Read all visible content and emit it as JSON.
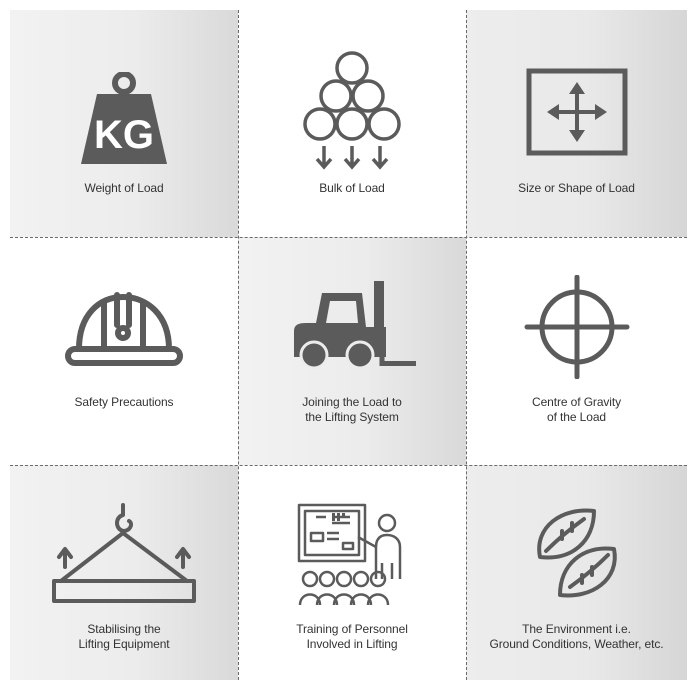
{
  "cells": [
    {
      "icon": "weight-kg-icon",
      "icon_text": "KG",
      "line1": "Weight of Load",
      "line2": ""
    },
    {
      "icon": "stacked-pipes-icon",
      "line1": "Bulk of Load",
      "line2": ""
    },
    {
      "icon": "move-arrows-icon",
      "line1": "Size or Shape of Load",
      "line2": ""
    },
    {
      "icon": "hard-hat-icon",
      "line1": "Safety Precautions",
      "line2": ""
    },
    {
      "icon": "forklift-icon",
      "line1": "Joining the Load to",
      "line2": "the Lifting System"
    },
    {
      "icon": "crosshair-icon",
      "line1": "Centre of Gravity",
      "line2": "of the Load"
    },
    {
      "icon": "crane-hook-load-icon",
      "line1": "Stabilising the",
      "line2": "Lifting Equipment"
    },
    {
      "icon": "presentation-audience-icon",
      "line1": "Training of Personnel",
      "line2": "Involved in Lifting"
    },
    {
      "icon": "leaves-environment-icon",
      "line1": "The Environment i.e.",
      "line2": "Ground Conditions, Weather, etc."
    }
  ],
  "colors": {
    "icon": "#5b5b5b",
    "text": "#333333",
    "grey_panel": "#e9e9e9",
    "divider": "#6a6a6a"
  }
}
